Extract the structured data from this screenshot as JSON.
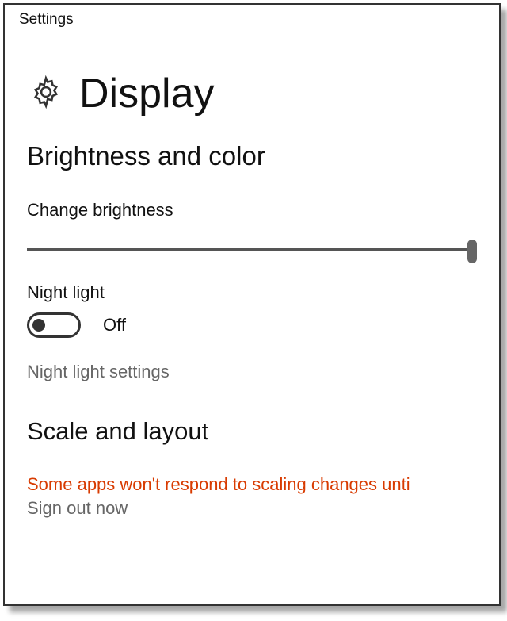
{
  "header": {
    "app": "Settings"
  },
  "page": {
    "title": "Display"
  },
  "sections": {
    "brightness": {
      "heading": "Brightness and color",
      "change_brightness_label": "Change brightness",
      "night_light_label": "Night light",
      "night_light_state": "Off",
      "night_light_settings_link": "Night light settings"
    },
    "scale": {
      "heading": "Scale and layout",
      "warning": "Some apps won't respond to scaling changes unti",
      "sign_out_link": "Sign out now"
    }
  }
}
